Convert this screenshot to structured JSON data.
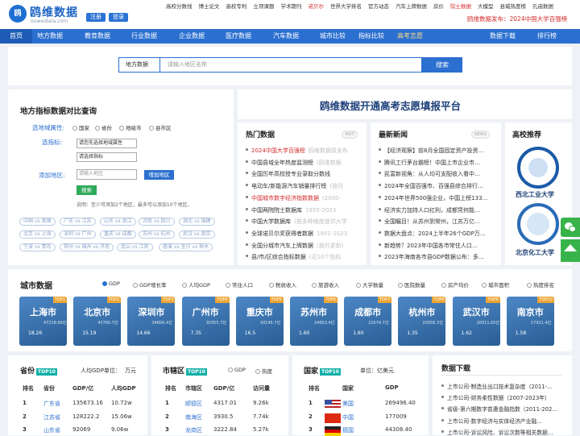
{
  "header": {
    "logo_mark": "鸥",
    "logo_text": "鸥维数据",
    "logo_domain": "ouweidata.com",
    "register": "注册",
    "login": "登录",
    "links": [
      "高校分数线",
      "博士论文",
      "高校专利",
      "立项课题",
      "学术期刊",
      "诺贝尔",
      "世界大学排名",
      "官方动态",
      "汽车上牌数据",
      "房价",
      "院士数据",
      "大模型",
      "县城热度榜",
      "孔庙数据"
    ],
    "notice": "鸥维数据发布：2024中国大学百强榜"
  },
  "nav": [
    "首页",
    "地方数据",
    "教育数据",
    "行业数据",
    "企业数据",
    "医疗数据",
    "汽车数据",
    "城市比较",
    "指标比较",
    "高考志愿",
    "数据下载",
    "排行榜"
  ],
  "search": {
    "select": "地方数据",
    "placeholder": "请输入地区名称",
    "button": "搜索"
  },
  "compare": {
    "title": "地方指标数据对比查询",
    "domain_label": "选地域属性:",
    "options": [
      "国家",
      "省份",
      "地级市",
      "县市区"
    ],
    "indicator_label": "选指标:",
    "sel1": "请您先选择地域属性",
    "sel2": "请选择指标",
    "region_label": "添加地区:",
    "region_placeholder": "请输入地区",
    "add_button": "增加地区",
    "search_button": "搜索",
    "hint": "说明：至少可添加2个地区，最多可以添加10个地区。",
    "tags": [
      "中国 vs 美国",
      "广东 vs 江苏",
      "山东 vs 浙江",
      "河南 vs 四川",
      "湖北 vs 福建",
      "北京 vs 上海",
      "深圳 vs 广州",
      "重庆 vs 成都",
      "苏州 vs 杭州",
      "武汉 vs 南京",
      "宁波 vs 青岛",
      "郑州 vs 福州 vs 济南",
      "昆山 vs 江阴",
      "慈溪 vs 宜兴 vs 神木"
    ]
  },
  "banner": "鸥维数据开通高考志愿填报平台",
  "hot": {
    "title": "热门数据",
    "badge": "HOT",
    "items": [
      {
        "t": "2024中国大学百强榜",
        "d": "鸥维数据原发布",
        "red": true
      },
      {
        "t": "中国县域全年热度监测榜",
        "d": "(鸥维数据"
      },
      {
        "t": "全国历年高校授专业录取分数线",
        "d": ""
      },
      {
        "t": "电动车/新能源汽车销量排行榜",
        "d": "(按月"
      },
      {
        "t": "中国城市数字经济指数数据",
        "d": "(2000-",
        "red": true
      },
      {
        "t": "中国两院院士数据库",
        "d": "1955-2023"
      },
      {
        "t": "中国大学数据库",
        "d": "(按多种维度提供大学"
      },
      {
        "t": "全球诺贝尔奖获得者数据",
        "d": "1901-2023"
      },
      {
        "t": "全国分城市汽车上牌数据",
        "d": "(按月更新)"
      },
      {
        "t": "县/市/区综合指标数据",
        "d": "(近10个指标"
      }
    ]
  },
  "news": {
    "title": "最新新闻",
    "badge": "NEWS",
    "items": [
      "【经济观察】前8月全国固定资产投资…",
      "腾讯工行茅台霸榜！中国上市企业市…",
      "民富新视角：从人均可支配收入看中…",
      "2024年全国百强市、百强县综合排行…",
      "2024年世界500强企业，中国上榜133…",
      "经济实力加持人口红利，成都凭何能…",
      "全国瞩目！从苏州到常州，江苏万亿…",
      "数据大盘点：2024上半年26个GDP万…",
      "新趋势？2023年中国各市常住人口…",
      "2023年海南各市县GDP数据公布：多…"
    ]
  },
  "univ": {
    "title": "高校推荐",
    "items": [
      "西北工业大学",
      "北京化工大学"
    ]
  },
  "city": {
    "title": "城市数据",
    "radios": [
      "GDP",
      "GDP增长率",
      "人均GDP",
      "常住人口",
      "税收收入",
      "旅游收入",
      "大学数量",
      "医院数量",
      "房产均价",
      "城市面积",
      "热度排名"
    ],
    "tiles": [
      {
        "name": "上海市",
        "top": "TOP1",
        "sub": "47218.66亿",
        "val": "18.26"
      },
      {
        "name": "北京市",
        "top": "TOP2",
        "sub": "43760.7亿",
        "val": "15.19"
      },
      {
        "name": "深圳市",
        "top": "TOP3",
        "sub": "34606.4亿",
        "val": "14.66"
      },
      {
        "name": "广州市",
        "top": "TOP4",
        "sub": "30355.7亿",
        "val": "7.35"
      },
      {
        "name": "重庆市",
        "top": "TOP5",
        "sub": "30145.7亿",
        "val": "16.5"
      },
      {
        "name": "苏州市",
        "top": "TOP6",
        "sub": "24653.4亿",
        "val": "1.60"
      },
      {
        "name": "成都市",
        "top": "TOP7",
        "sub": "22074.7亿",
        "val": "1.60"
      },
      {
        "name": "杭州市",
        "top": "TOP8",
        "sub": "20058.3亿",
        "val": "1.35"
      },
      {
        "name": "武汉市",
        "top": "TOP9",
        "sub": "20011.65亿",
        "val": "1.62"
      },
      {
        "name": "南京市",
        "top": "TOP10",
        "sub": "17421.4亿",
        "val": "1.58"
      }
    ]
  },
  "prov": {
    "title": "省份",
    "top": "TOP10",
    "unit1": "人均GDP单位：",
    "unit2": "万元",
    "head": [
      "排名",
      "省份",
      "GDP/亿",
      "人均GDP"
    ],
    "rows": [
      [
        "1",
        "广东省",
        "135673.16",
        "10.72w"
      ],
      [
        "2",
        "江苏省",
        "128222.2",
        "15.06w"
      ],
      [
        "3",
        "山东省",
        "92069",
        "9.06w"
      ]
    ]
  },
  "district": {
    "title": "市辖区",
    "top": "TOP10",
    "opts": [
      "GDP",
      "热度"
    ],
    "head": [
      "排名",
      "市辖区",
      "GDP/亿",
      "访问量"
    ],
    "rows": [
      [
        "1",
        "顺德区",
        "4317.01",
        "9.26k"
      ],
      [
        "2",
        "南海区",
        "3930.5",
        "7.74k"
      ],
      [
        "3",
        "龙岗区",
        "3222.84",
        "5.27k"
      ]
    ]
  },
  "country": {
    "title": "国家",
    "top": "TOP10",
    "unit": "单位：亿美元",
    "head": [
      "排名",
      "国家",
      "GDP"
    ],
    "rows": [
      [
        "1",
        "美国",
        "269496.40"
      ],
      [
        "2",
        "中国",
        "177009"
      ],
      [
        "3",
        "德国",
        "44308.40"
      ]
    ]
  },
  "download": {
    "title": "数据下载",
    "items": [
      "上市公司-制造业出口技术复杂度（2011-…",
      "上市公司-财务柔性数据（2007-2023年）",
      "省级-第六期数字普惠金融指数（2011-202…",
      "上市公司-数字经济与实体经济产业融…",
      "上市公司-诉讼风险、诉讼次数等相关数据…"
    ]
  }
}
